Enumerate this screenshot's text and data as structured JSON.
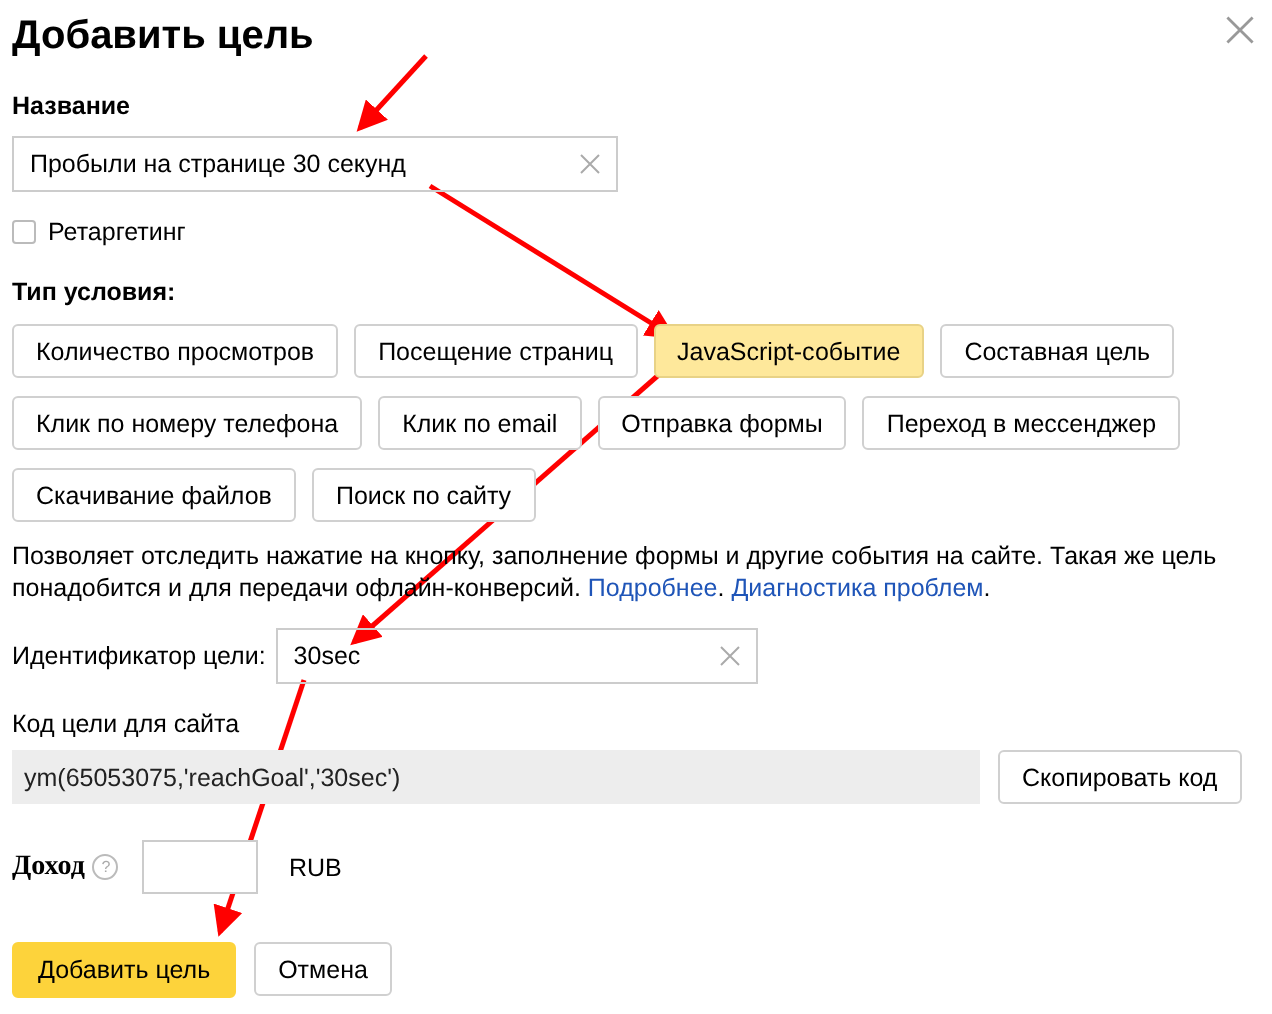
{
  "dialog": {
    "title": "Добавить цель"
  },
  "name_field": {
    "label": "Название",
    "value": "Пробыли на странице 30 секунд"
  },
  "retargeting": {
    "label": "Ретаргетинг",
    "checked": false
  },
  "condition": {
    "label": "Тип условия:",
    "types": [
      {
        "label": "Количество просмотров",
        "selected": false
      },
      {
        "label": "Посещение страниц",
        "selected": false
      },
      {
        "label": "JavaScript-событие",
        "selected": true
      },
      {
        "label": "Составная цель",
        "selected": false
      },
      {
        "label": "Клик по номеру телефона",
        "selected": false
      },
      {
        "label": "Клик по email",
        "selected": false
      },
      {
        "label": "Отправка формы",
        "selected": false
      },
      {
        "label": "Переход в мессенджер",
        "selected": false
      },
      {
        "label": "Скачивание файлов",
        "selected": false
      },
      {
        "label": "Поиск по сайту",
        "selected": false
      }
    ]
  },
  "description": [
    {
      "kind": "text",
      "text": "Позволяет отследить нажатие на кнопку, заполнение формы и другие события на сайте. Такая же цель понадобится и для передачи офлайн-конверсий. "
    },
    {
      "kind": "link",
      "text": "Подробнее"
    },
    {
      "kind": "text",
      "text": ". "
    },
    {
      "kind": "link",
      "text": "Диагностика проблем"
    },
    {
      "kind": "text",
      "text": "."
    }
  ],
  "identifier": {
    "label": "Идентификатор цели:",
    "value": "30sec"
  },
  "site_code": {
    "label": "Код цели для сайта",
    "code": "ym(65053075,'reachGoal','30sec')",
    "copy_button": "Скопировать код"
  },
  "revenue": {
    "label": "Доход",
    "help": "?",
    "currency": "RUB"
  },
  "buttons": [
    {
      "label": "Добавить цель",
      "kind": "primary"
    },
    {
      "label": "Отмена",
      "kind": "secondary"
    }
  ]
}
